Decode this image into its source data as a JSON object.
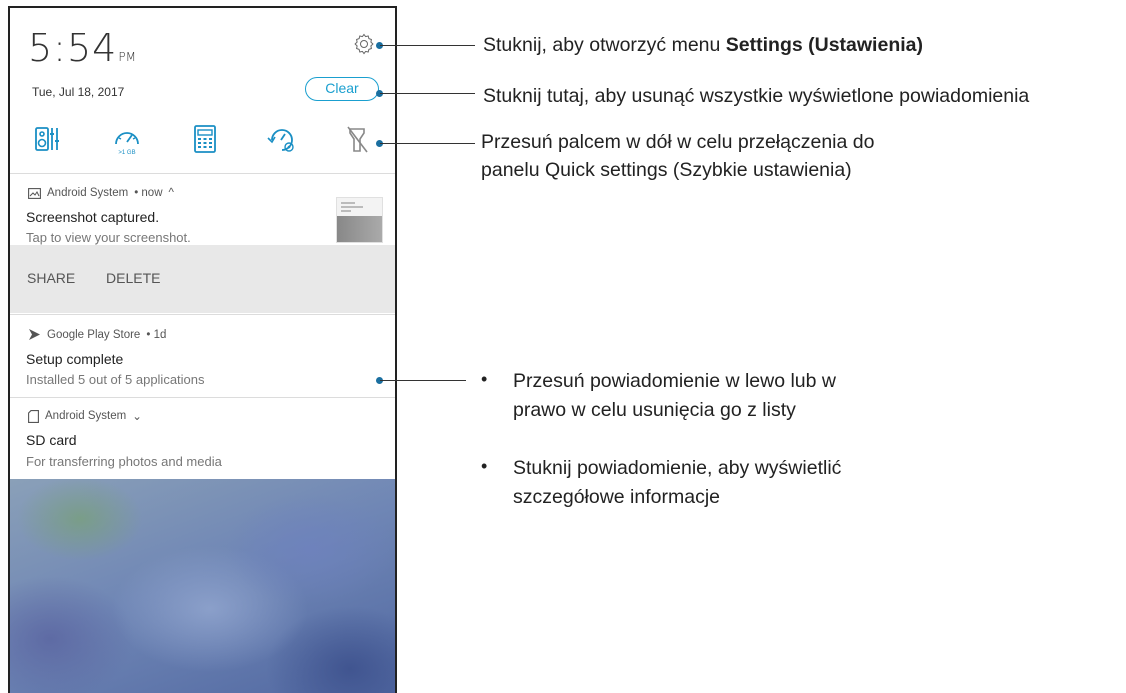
{
  "status": {
    "time": "5:54",
    "ampm": "PM",
    "date": "Tue, Jul 18, 2017",
    "clear_label": "Clear"
  },
  "icons": {
    "settings": "gear-icon",
    "quick_settings": [
      "audio-wizard-icon",
      "mobile-data-limit-icon",
      "calculator-icon",
      "boost-icon",
      "flashlight-off-icon"
    ]
  },
  "notifications": [
    {
      "app": "Android System",
      "meta": "• now",
      "chevron": "^",
      "title": "Screenshot captured.",
      "subtitle": "Tap to view your screenshot.",
      "actions": [
        "SHARE",
        "DELETE"
      ]
    },
    {
      "app": "Google Play Store",
      "meta": "• 1d",
      "title": "Setup complete",
      "subtitle": "Installed 5 out of 5 applications"
    },
    {
      "app": "Android System",
      "chevron": "⌄",
      "title": "SD card",
      "subtitle": "For transferring photos and media"
    }
  ],
  "callouts": {
    "settings_prefix": "Stuknij, aby otworzyć menu ",
    "settings_bold": "Settings (Ustawienia)",
    "clear": "Stuknij tutaj, aby usunąć wszystkie wyświetlone powiadomienia",
    "quick_line1": "Przesuń palcem w dół w celu przełączenia do",
    "quick_line2": "panelu Quick settings (Szybkie ustawienia)",
    "bullet_char": "•",
    "bullet1_line1": "Przesuń powiadomienie w lewo lub w",
    "bullet1_line2": "prawo w celu usunięcia go z listy",
    "bullet2_line1": "Stuknij powiadomienie, aby wyświetlić",
    "bullet2_line2": "szczegółowe informacje"
  },
  "colors": {
    "accent": "#1a9fcf",
    "icon": "#1a8fc4",
    "callout_dot": "#1a6fa0"
  }
}
